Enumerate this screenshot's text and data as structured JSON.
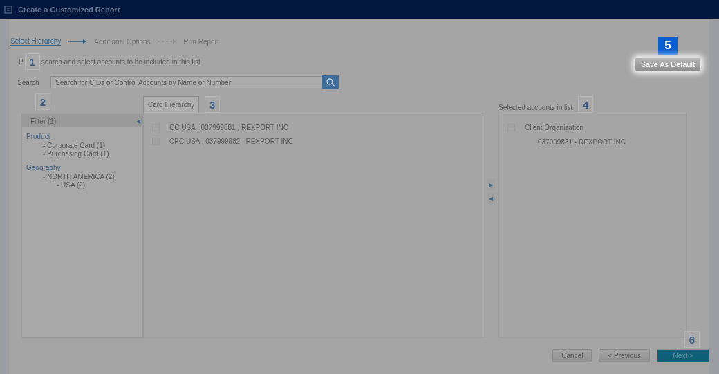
{
  "window": {
    "title": "Create a Customized Report"
  },
  "steps": [
    {
      "label": "Select Hierarchy",
      "selected": true
    },
    {
      "label": "Additional Options",
      "selected": false
    },
    {
      "label": "Run Report",
      "selected": false
    }
  ],
  "instruction": {
    "before": "P",
    "after": "search and select accounts to be included in this list"
  },
  "save_default_button": "Save As Default",
  "search": {
    "label": "Search",
    "placeholder": "Search for CIDs or Control Accounts by Name or Number"
  },
  "filter": {
    "title": "Filter (1)",
    "collapse": "◀",
    "groups": [
      {
        "name": "Product",
        "children": [
          {
            "label": "- Corporate Card (1)"
          },
          {
            "label": "- Purchasing Card (1)"
          }
        ]
      },
      {
        "name": "Geography",
        "children": [
          {
            "label": "- NORTH AMERICA (2)",
            "children": [
              {
                "label": "- USA (2)"
              }
            ]
          }
        ]
      }
    ]
  },
  "hierarchy_tab": {
    "label": "Card Hierarchy",
    "selected": true
  },
  "accounts": [
    {
      "label": "CC USA , 037999881 , REXPORT INC",
      "checked": false
    },
    {
      "label": "CPC USA , 037999882 , REXPORT INC",
      "checked": false
    }
  ],
  "move_buttons": [
    "▶",
    "◀"
  ],
  "selected_list": {
    "title": "Selected accounts in list",
    "group": "Client Organization",
    "checked": false,
    "items": [
      "037999881 - REXPORT INC"
    ]
  },
  "buttons": [
    {
      "label": "Cancel",
      "kind": "secondary"
    },
    {
      "label": "< Previous",
      "kind": "secondary"
    },
    {
      "label": "Next >",
      "kind": "primary"
    }
  ],
  "callouts": [
    {
      "number": "1",
      "highlighted": false
    },
    {
      "number": "2",
      "highlighted": false
    },
    {
      "number": "3",
      "highlighted": false
    },
    {
      "number": "4",
      "highlighted": false
    },
    {
      "number": "5",
      "highlighted": true
    },
    {
      "number": "6",
      "highlighted": false
    }
  ]
}
